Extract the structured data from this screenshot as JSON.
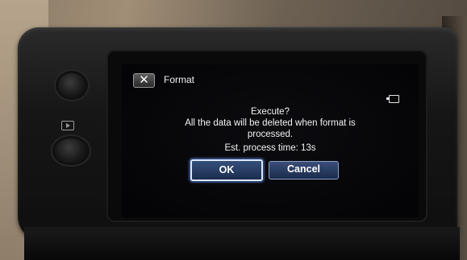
{
  "dialog": {
    "close_icon": "close-icon",
    "close_glyph": "✕",
    "title": "Format",
    "media_icon": "memory-card-icon",
    "message_line1": "Execute?",
    "message_line2": "All the data will be deleted when format is",
    "message_line3": "processed.",
    "message_line4": "Est. process time: 13s",
    "ok_label": "OK",
    "cancel_label": "Cancel"
  },
  "hardware": {
    "playback_icon": "playback-icon"
  },
  "colors": {
    "button_fill": "#1b2d4f",
    "selected_outline": "#dfe7ff",
    "screen_background": "#030305"
  }
}
